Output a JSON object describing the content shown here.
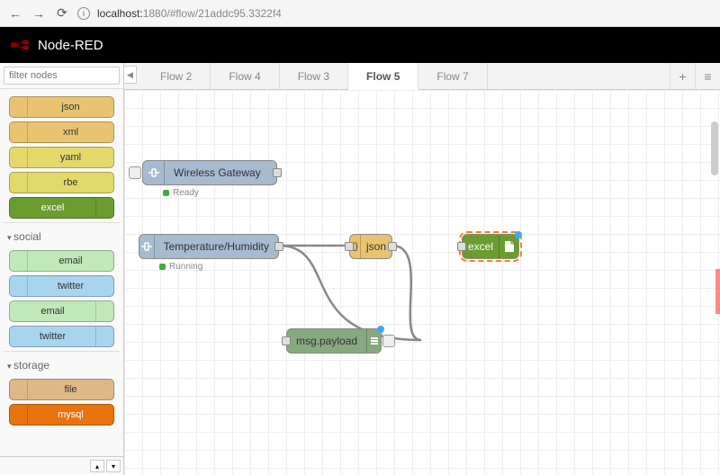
{
  "browser": {
    "url_host": "localhost:",
    "url_port": "1880",
    "url_path": "/#flow/21addc95.3322f4"
  },
  "header": {
    "title": "Node-RED"
  },
  "sidebar": {
    "filter_placeholder": "filter nodes",
    "nodes_top": [
      {
        "label": "json",
        "cls": "c-json",
        "side": "left"
      },
      {
        "label": "xml",
        "cls": "c-xml",
        "side": "left"
      },
      {
        "label": "yaml",
        "cls": "c-yaml",
        "side": "left"
      },
      {
        "label": "rbe",
        "cls": "c-rbe",
        "side": "left"
      },
      {
        "label": "excel",
        "cls": "c-excel",
        "side": "right"
      }
    ],
    "cat_social": "social",
    "nodes_social": [
      {
        "label": "email",
        "cls": "c-email",
        "side": "left"
      },
      {
        "label": "twitter",
        "cls": "c-twitter",
        "side": "left"
      },
      {
        "label": "email",
        "cls": "c-email",
        "side": "right"
      },
      {
        "label": "twitter",
        "cls": "c-twitter",
        "side": "right"
      }
    ],
    "cat_storage": "storage",
    "nodes_storage": [
      {
        "label": "file",
        "cls": "c-file",
        "side": "left"
      },
      {
        "label": "mysql",
        "cls": "c-mysql",
        "side": "left"
      }
    ]
  },
  "tabs": {
    "items": [
      {
        "label": "Flow 2"
      },
      {
        "label": "Flow 4"
      },
      {
        "label": "Flow 3"
      },
      {
        "label": "Flow 5"
      },
      {
        "label": "Flow 7"
      }
    ],
    "active_index": 3
  },
  "flow": {
    "wireless_gateway": {
      "label": "Wireless Gateway",
      "status": "Ready"
    },
    "temp_humidity": {
      "label": "Temperature/Humidity",
      "status": "Running"
    },
    "json": {
      "label": "json"
    },
    "excel": {
      "label": "excel"
    },
    "debug": {
      "label": "msg.payload"
    }
  }
}
